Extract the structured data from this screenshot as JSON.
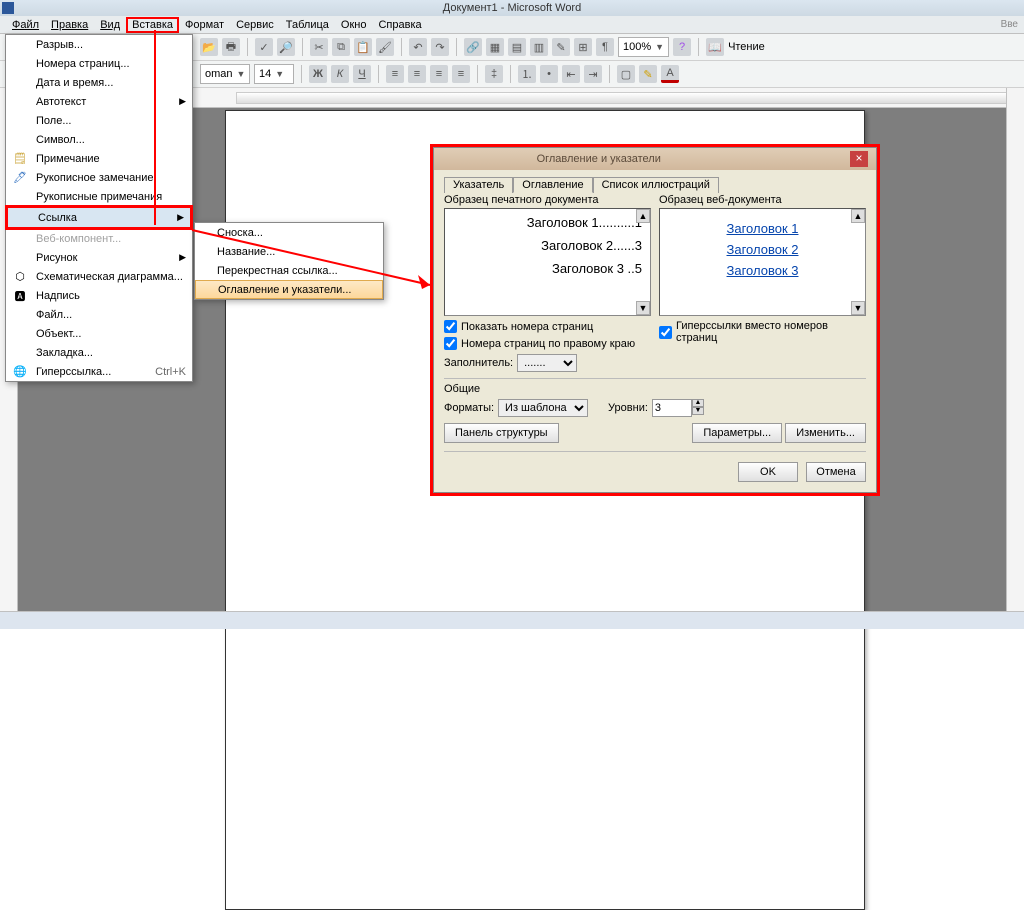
{
  "title": "Документ1 - Microsoft Word",
  "menubar": {
    "file": "Файл",
    "edit": "Правка",
    "view": "Вид",
    "insert": "Вставка",
    "format": "Формат",
    "service": "Сервис",
    "table": "Таблица",
    "window": "Окно",
    "help": "Справка"
  },
  "toolbar2": {
    "font_name": "oman",
    "font_size": "14",
    "zoom": "100%",
    "reading": "Чтение"
  },
  "dropmenu": {
    "break": "Разрыв...",
    "page_numbers": "Номера страниц...",
    "date_time": "Дата и время...",
    "autotext": "Автотекст",
    "field": "Поле...",
    "symbol": "Символ...",
    "note": "Примечание",
    "ink_mark": "Рукописное замечание",
    "ink_notes": "Рукописные примечания",
    "reference": "Ссылка",
    "web_component": "Веб-компонент...",
    "picture": "Рисунок",
    "diagram": "Схематическая диаграмма...",
    "caption_box": "Надпись",
    "file": "Файл...",
    "object": "Объект...",
    "bookmark": "Закладка...",
    "hyperlink": "Гиперссылка...",
    "hyperlink_shortcut": "Ctrl+K"
  },
  "submenu": {
    "footnote": "Сноска...",
    "caption": "Название...",
    "crossref": "Перекрестная ссылка...",
    "toc": "Оглавление и указатели..."
  },
  "dialog": {
    "title": "Оглавление и указатели",
    "tab_index": "Указатель",
    "tab_toc": "Оглавление",
    "tab_illustrations": "Список иллюстраций",
    "preview_print_label": "Образец печатного документа",
    "preview_web_label": "Образец веб-документа",
    "h1": "Заголовок 1",
    "h2": "Заголовок 2",
    "h3": "Заголовок 3",
    "print_line1": "Заголовок 1..........1",
    "print_line2": "Заголовок 2......3",
    "print_line3": "Заголовок 3 ..5",
    "show_pages": "Показать номера страниц",
    "right_align": "Номера страниц по правому краю",
    "hyperlinks_instead": "Гиперссылки вместо номеров страниц",
    "leader_label": "Заполнитель:",
    "leader_value": ".......",
    "general_group": "Общие",
    "formats_label": "Форматы:",
    "formats_value": "Из шаблона",
    "levels_label": "Уровни:",
    "levels_value": "3",
    "outline_btn": "Панель структуры",
    "options_btn": "Параметры...",
    "modify_btn": "Изменить...",
    "ok": "OK",
    "cancel": "Отмена"
  },
  "rightedge_label": "Вве"
}
